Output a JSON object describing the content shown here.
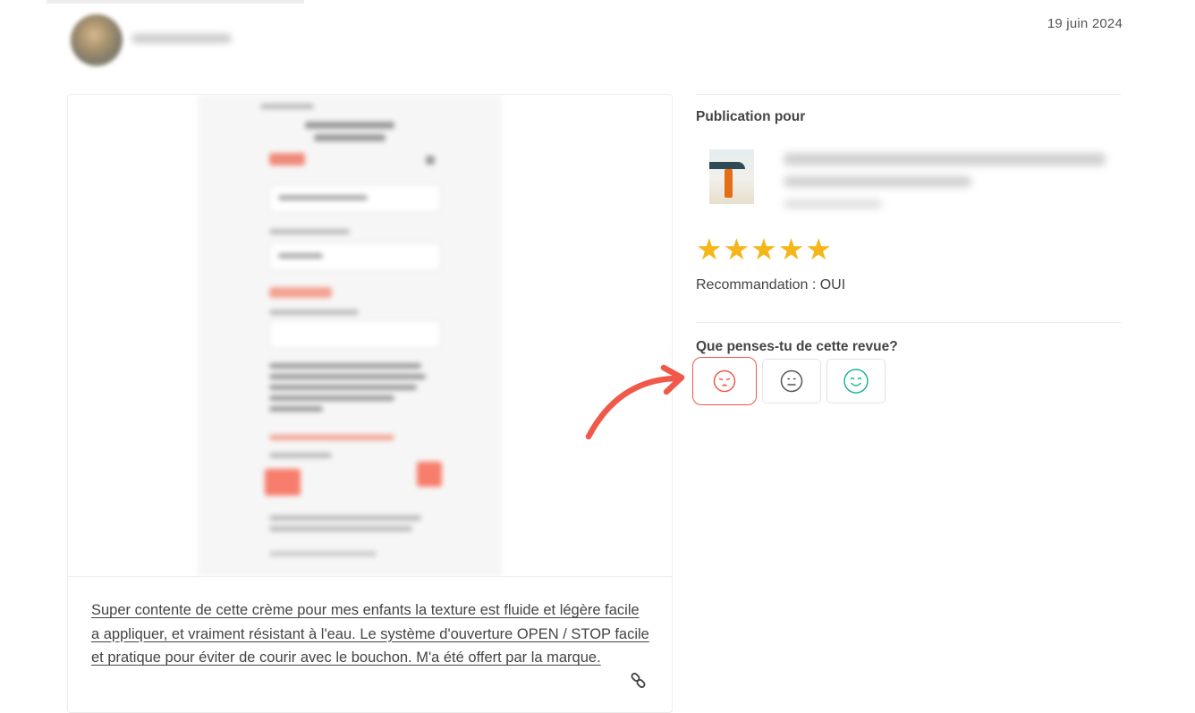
{
  "header": {
    "date": "19 juin 2024"
  },
  "review": {
    "text": "Super contente de cette crème pour mes enfants la texture est fluide et légère facile a appliquer, et vraiment résistant à l'eau. Le système d'ouverture OPEN / STOP facile et pratique pour éviter de courir avec le bouchon. M'a été offert par la marque."
  },
  "sidebar": {
    "publication_label": "Publication pour",
    "rating": 5,
    "rating_max": 5,
    "stars_text": "★★★★★",
    "recommendation": "Recommandation : OUI",
    "question": "Que penses-tu de cette revue?",
    "reactions": [
      {
        "icon": "sad-face-icon",
        "color": "#f0594a",
        "selected": true
      },
      {
        "icon": "neutral-face-icon",
        "color": "#555555",
        "selected": false
      },
      {
        "icon": "happy-face-icon",
        "color": "#1fb59a",
        "selected": false
      }
    ]
  },
  "colors": {
    "accent": "#f0594a",
    "star": "#f5b619",
    "positive": "#1fb59a"
  }
}
